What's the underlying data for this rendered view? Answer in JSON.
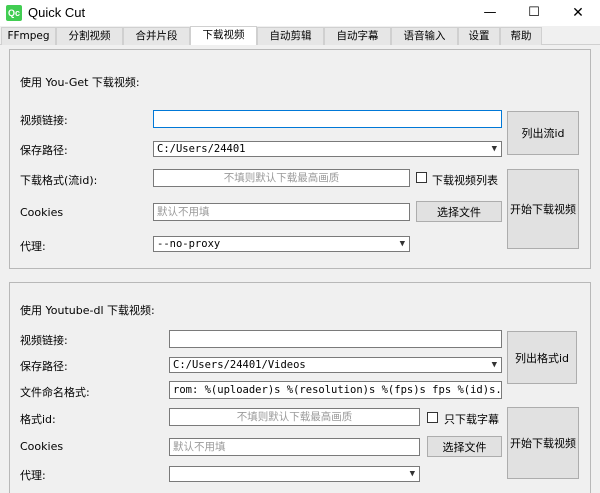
{
  "window": {
    "icon_text": "Qc",
    "title": "Quick Cut",
    "minimize": "—",
    "maximize": "☐",
    "close": "✕"
  },
  "tabs": [
    {
      "label": "FFmpeg"
    },
    {
      "label": "分割视频"
    },
    {
      "label": "合并片段"
    },
    {
      "label": "下载视频",
      "active": true
    },
    {
      "label": "自动剪辑"
    },
    {
      "label": "自动字幕"
    },
    {
      "label": "语音输入"
    },
    {
      "label": "设置"
    },
    {
      "label": "帮助"
    }
  ],
  "youget": {
    "title": "使用 You-Get 下载视频:",
    "link_label": "视频链接:",
    "link_value": "",
    "save_label": "保存路径:",
    "save_value": "C:/Users/24401",
    "format_label": "下载格式(流id):",
    "format_placeholder": "不填则默认下载最高画质",
    "playlist_label": "下载视频列表",
    "playlist_checked": false,
    "cookies_label": "Cookies",
    "cookies_placeholder": "默认不用填",
    "choose_file": "选择文件",
    "proxy_label": "代理:",
    "proxy_value": "--no-proxy",
    "list_button": "列出流id",
    "start_button": "开始下载视频"
  },
  "ytdl": {
    "title": "使用 Youtube-dl 下载视频:",
    "link_label": "视频链接:",
    "link_value": "",
    "save_label": "保存路径:",
    "save_value": "C:/Users/24401/Videos",
    "naming_label": "文件命名格式:",
    "naming_value": "rom: %(uploader)s %(resolution)s %(fps)s fps %(id)s.%(ext)s",
    "format_label": "格式id:",
    "format_placeholder": "不填则默认下载最高画质",
    "subs_only_label": "只下载字幕",
    "subs_only_checked": false,
    "cookies_label": "Cookies",
    "cookies_placeholder": "默认不用填",
    "choose_file": "选择文件",
    "proxy_label": "代理:",
    "proxy_value": "",
    "list_button": "列出格式id",
    "start_button": "开始下载视频"
  },
  "colors": {
    "focus_border": "#0078d7",
    "app_icon": "#41cd52"
  }
}
